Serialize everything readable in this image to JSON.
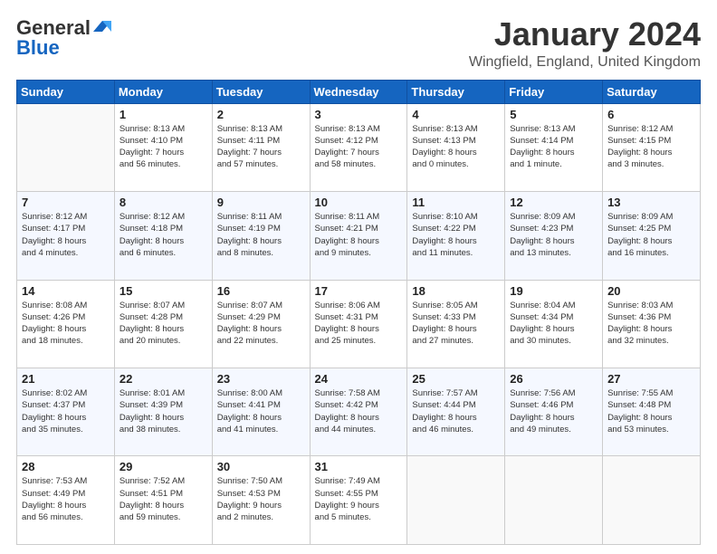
{
  "header": {
    "logo": {
      "line1": "General",
      "line2": "Blue"
    },
    "title": "January 2024",
    "location": "Wingfield, England, United Kingdom"
  },
  "weekdays": [
    "Sunday",
    "Monday",
    "Tuesday",
    "Wednesday",
    "Thursday",
    "Friday",
    "Saturday"
  ],
  "weeks": [
    [
      {
        "day": "",
        "sunrise": "",
        "sunset": "",
        "daylight": ""
      },
      {
        "day": "1",
        "sunrise": "Sunrise: 8:13 AM",
        "sunset": "Sunset: 4:10 PM",
        "daylight": "Daylight: 7 hours and 56 minutes."
      },
      {
        "day": "2",
        "sunrise": "Sunrise: 8:13 AM",
        "sunset": "Sunset: 4:11 PM",
        "daylight": "Daylight: 7 hours and 57 minutes."
      },
      {
        "day": "3",
        "sunrise": "Sunrise: 8:13 AM",
        "sunset": "Sunset: 4:12 PM",
        "daylight": "Daylight: 7 hours and 58 minutes."
      },
      {
        "day": "4",
        "sunrise": "Sunrise: 8:13 AM",
        "sunset": "Sunset: 4:13 PM",
        "daylight": "Daylight: 8 hours and 0 minutes."
      },
      {
        "day": "5",
        "sunrise": "Sunrise: 8:13 AM",
        "sunset": "Sunset: 4:14 PM",
        "daylight": "Daylight: 8 hours and 1 minute."
      },
      {
        "day": "6",
        "sunrise": "Sunrise: 8:12 AM",
        "sunset": "Sunset: 4:15 PM",
        "daylight": "Daylight: 8 hours and 3 minutes."
      }
    ],
    [
      {
        "day": "7",
        "sunrise": "Sunrise: 8:12 AM",
        "sunset": "Sunset: 4:17 PM",
        "daylight": "Daylight: 8 hours and 4 minutes."
      },
      {
        "day": "8",
        "sunrise": "Sunrise: 8:12 AM",
        "sunset": "Sunset: 4:18 PM",
        "daylight": "Daylight: 8 hours and 6 minutes."
      },
      {
        "day": "9",
        "sunrise": "Sunrise: 8:11 AM",
        "sunset": "Sunset: 4:19 PM",
        "daylight": "Daylight: 8 hours and 8 minutes."
      },
      {
        "day": "10",
        "sunrise": "Sunrise: 8:11 AM",
        "sunset": "Sunset: 4:21 PM",
        "daylight": "Daylight: 8 hours and 9 minutes."
      },
      {
        "day": "11",
        "sunrise": "Sunrise: 8:10 AM",
        "sunset": "Sunset: 4:22 PM",
        "daylight": "Daylight: 8 hours and 11 minutes."
      },
      {
        "day": "12",
        "sunrise": "Sunrise: 8:09 AM",
        "sunset": "Sunset: 4:23 PM",
        "daylight": "Daylight: 8 hours and 13 minutes."
      },
      {
        "day": "13",
        "sunrise": "Sunrise: 8:09 AM",
        "sunset": "Sunset: 4:25 PM",
        "daylight": "Daylight: 8 hours and 16 minutes."
      }
    ],
    [
      {
        "day": "14",
        "sunrise": "Sunrise: 8:08 AM",
        "sunset": "Sunset: 4:26 PM",
        "daylight": "Daylight: 8 hours and 18 minutes."
      },
      {
        "day": "15",
        "sunrise": "Sunrise: 8:07 AM",
        "sunset": "Sunset: 4:28 PM",
        "daylight": "Daylight: 8 hours and 20 minutes."
      },
      {
        "day": "16",
        "sunrise": "Sunrise: 8:07 AM",
        "sunset": "Sunset: 4:29 PM",
        "daylight": "Daylight: 8 hours and 22 minutes."
      },
      {
        "day": "17",
        "sunrise": "Sunrise: 8:06 AM",
        "sunset": "Sunset: 4:31 PM",
        "daylight": "Daylight: 8 hours and 25 minutes."
      },
      {
        "day": "18",
        "sunrise": "Sunrise: 8:05 AM",
        "sunset": "Sunset: 4:33 PM",
        "daylight": "Daylight: 8 hours and 27 minutes."
      },
      {
        "day": "19",
        "sunrise": "Sunrise: 8:04 AM",
        "sunset": "Sunset: 4:34 PM",
        "daylight": "Daylight: 8 hours and 30 minutes."
      },
      {
        "day": "20",
        "sunrise": "Sunrise: 8:03 AM",
        "sunset": "Sunset: 4:36 PM",
        "daylight": "Daylight: 8 hours and 32 minutes."
      }
    ],
    [
      {
        "day": "21",
        "sunrise": "Sunrise: 8:02 AM",
        "sunset": "Sunset: 4:37 PM",
        "daylight": "Daylight: 8 hours and 35 minutes."
      },
      {
        "day": "22",
        "sunrise": "Sunrise: 8:01 AM",
        "sunset": "Sunset: 4:39 PM",
        "daylight": "Daylight: 8 hours and 38 minutes."
      },
      {
        "day": "23",
        "sunrise": "Sunrise: 8:00 AM",
        "sunset": "Sunset: 4:41 PM",
        "daylight": "Daylight: 8 hours and 41 minutes."
      },
      {
        "day": "24",
        "sunrise": "Sunrise: 7:58 AM",
        "sunset": "Sunset: 4:42 PM",
        "daylight": "Daylight: 8 hours and 44 minutes."
      },
      {
        "day": "25",
        "sunrise": "Sunrise: 7:57 AM",
        "sunset": "Sunset: 4:44 PM",
        "daylight": "Daylight: 8 hours and 46 minutes."
      },
      {
        "day": "26",
        "sunrise": "Sunrise: 7:56 AM",
        "sunset": "Sunset: 4:46 PM",
        "daylight": "Daylight: 8 hours and 49 minutes."
      },
      {
        "day": "27",
        "sunrise": "Sunrise: 7:55 AM",
        "sunset": "Sunset: 4:48 PM",
        "daylight": "Daylight: 8 hours and 53 minutes."
      }
    ],
    [
      {
        "day": "28",
        "sunrise": "Sunrise: 7:53 AM",
        "sunset": "Sunset: 4:49 PM",
        "daylight": "Daylight: 8 hours and 56 minutes."
      },
      {
        "day": "29",
        "sunrise": "Sunrise: 7:52 AM",
        "sunset": "Sunset: 4:51 PM",
        "daylight": "Daylight: 8 hours and 59 minutes."
      },
      {
        "day": "30",
        "sunrise": "Sunrise: 7:50 AM",
        "sunset": "Sunset: 4:53 PM",
        "daylight": "Daylight: 9 hours and 2 minutes."
      },
      {
        "day": "31",
        "sunrise": "Sunrise: 7:49 AM",
        "sunset": "Sunset: 4:55 PM",
        "daylight": "Daylight: 9 hours and 5 minutes."
      },
      {
        "day": "",
        "sunrise": "",
        "sunset": "",
        "daylight": ""
      },
      {
        "day": "",
        "sunrise": "",
        "sunset": "",
        "daylight": ""
      },
      {
        "day": "",
        "sunrise": "",
        "sunset": "",
        "daylight": ""
      }
    ]
  ]
}
